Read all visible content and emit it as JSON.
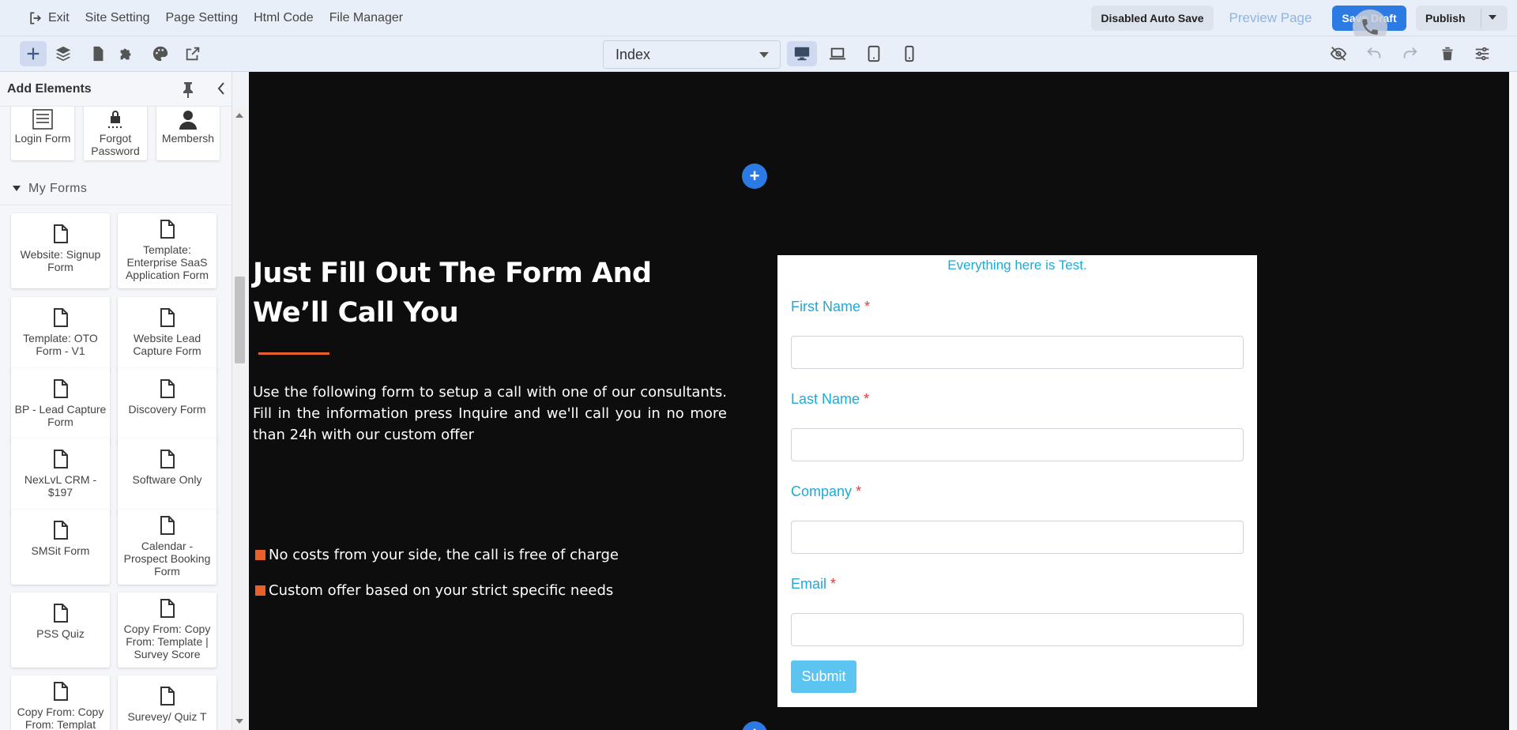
{
  "topbar": {
    "menu": [
      "Exit",
      "Site Setting",
      "Page Setting",
      "Html Code",
      "File Manager"
    ],
    "autosave_label": "Disabled Auto Save",
    "preview_label": "Preview Page",
    "save_label": "Save Draft",
    "publish_label": "Publish"
  },
  "toolbar": {
    "page_select_value": "Index"
  },
  "left_panel": {
    "title": "Add Elements",
    "top_cards": [
      "Login Form",
      "Forgot Password",
      "Membersh"
    ],
    "section_title": "My Forms",
    "forms": [
      "Website: Signup Form",
      "Template: Enterprise SaaS Application Form",
      "Template: OTO Form - V1",
      "Website Lead Capture Form",
      "BP - Lead Capture Form",
      "Discovery Form",
      "NexLvL CRM - $197",
      "Software Only",
      "SMSit Form",
      "Calendar - Prospect Booking Form",
      "PSS Quiz",
      "Copy From: Copy From: Template | Survey Score",
      "Copy From: Copy From: Templat",
      "Surevey/ Quiz T"
    ]
  },
  "canvas": {
    "headline": "Just Fill Out The Form And We’ll Call You",
    "paragraph": "Use the following form to setup a call with one of our consultants. Fill in the information press Inquire and we'll call you in no more than 24h with our custom offer",
    "bullets": [
      "No costs from your side, the call is free of charge",
      "Custom offer based on your strict specific needs"
    ],
    "form": {
      "note": "Everything here is Test.",
      "fields": [
        "First Name",
        "Last Name",
        "Company",
        "Email"
      ],
      "required_mark": "*",
      "submit_label": "Submit"
    },
    "add_symbol": "+"
  },
  "colors": {
    "accent": "#2c7be5",
    "orange": "#e8612c",
    "form_label": "#1fa9d8",
    "canvas_bg": "#0d0d0d"
  }
}
